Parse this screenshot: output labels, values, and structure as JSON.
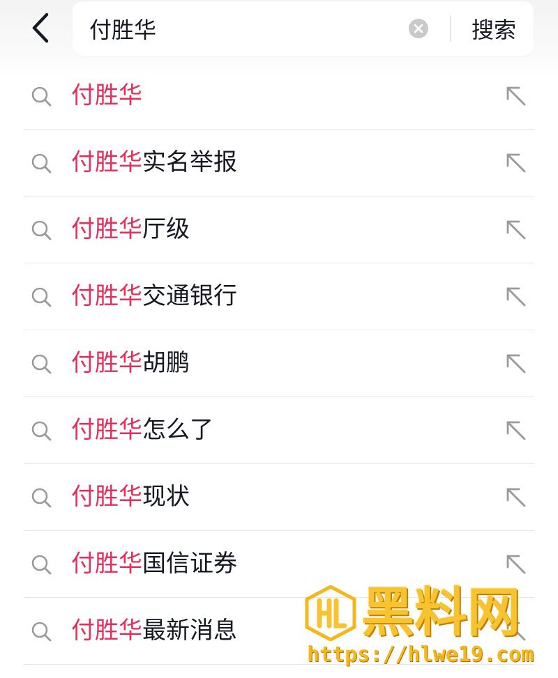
{
  "header": {
    "back_icon": "chevron-left-icon",
    "search_value": "付胜华",
    "clear_icon": "clear-circle-icon",
    "search_button_label": "搜索"
  },
  "suggestions": [
    {
      "highlight": "付胜华",
      "rest": ""
    },
    {
      "highlight": "付胜华",
      "rest": "实名举报"
    },
    {
      "highlight": "付胜华",
      "rest": "厅级"
    },
    {
      "highlight": "付胜华",
      "rest": "交通银行"
    },
    {
      "highlight": "付胜华",
      "rest": "胡鹏"
    },
    {
      "highlight": "付胜华",
      "rest": "怎么了"
    },
    {
      "highlight": "付胜华",
      "rest": "现状"
    },
    {
      "highlight": "付胜华",
      "rest": "国信证券"
    },
    {
      "highlight": "付胜华",
      "rest": "最新消息"
    }
  ],
  "watermark": {
    "title": "黑料网",
    "url": "https://hlwe19.com"
  },
  "colors": {
    "highlight": "#e2305a",
    "text": "#161823",
    "icon_gray": "#9a9a9a",
    "watermark_gold": "#f7c330"
  }
}
